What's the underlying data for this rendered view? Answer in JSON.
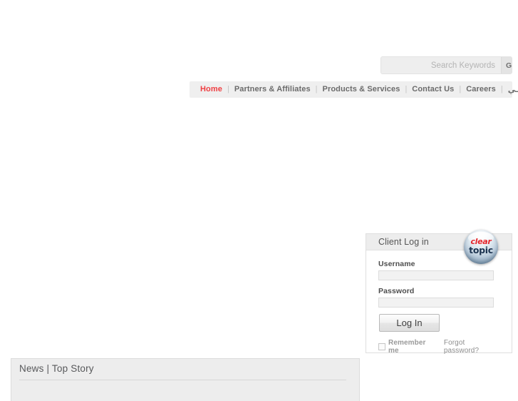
{
  "search": {
    "placeholder": "Search Keywords",
    "value": "",
    "go_label": "GO"
  },
  "nav": {
    "items": [
      {
        "label": "Home",
        "active": true
      },
      {
        "label": "Partners & Affiliates",
        "active": false
      },
      {
        "label": "Products & Services",
        "active": false
      },
      {
        "label": "Contact Us",
        "active": false
      },
      {
        "label": "Careers",
        "active": false
      },
      {
        "label": "عربــي",
        "active": false
      }
    ],
    "separator": "|",
    "active_color": "#ef3e42",
    "inactive_color": "#6b6b6b",
    "background": "#efefef"
  },
  "login": {
    "title": "Client Log in",
    "username_label": "Username",
    "username_value": "",
    "password_label": "Password",
    "password_value": "",
    "submit_label": "Log In",
    "remember_label": "Remember me",
    "remember_checked": false,
    "forgot_label": "Forgot password?"
  },
  "logo": {
    "word_top": "clear",
    "word_bottom": "topic",
    "color_top": "#e4262c",
    "color_bottom": "#1b3350"
  },
  "news": {
    "title": "News | Top Story"
  }
}
